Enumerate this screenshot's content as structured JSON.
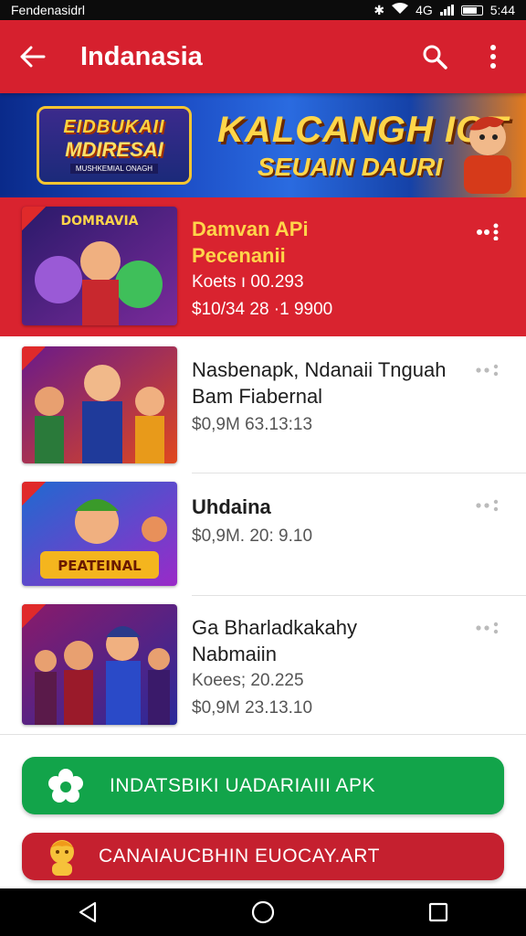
{
  "status_bar": {
    "carrier": "Fendenasidrl",
    "time": "5:44",
    "net_label": "4G"
  },
  "app_bar": {
    "title": "Indanasia",
    "icons": [
      "back-arrow-icon",
      "search-icon",
      "more-vert-icon"
    ]
  },
  "banner": {
    "badge_line1": "EIDBUKAII",
    "badge_line2": "MDIRESAI",
    "badge_line3": "MUSHKEMIAL ONAGH",
    "headline": "KALCANGH IGT",
    "subline": "SEUAIN DAURI"
  },
  "items": [
    {
      "title_lines": [
        "Damvan APi",
        "Pecenanii"
      ],
      "meta_lines": [
        "Koets ı 00.293",
        "$10/34  28 ·1 9900"
      ],
      "featured": true
    },
    {
      "title_lines": [
        "Nasbenapk, Ndanaii Tnguah",
        "Bam Fiabernal"
      ],
      "meta_lines": [
        "$0,9M  63.13:13"
      ],
      "featured": false
    },
    {
      "title_lines": [
        "Uhdaina"
      ],
      "meta_lines": [
        "$0,9M.  20: 9.10"
      ],
      "featured": false
    },
    {
      "title_lines": [
        "Ga Bharladkakahy",
        "Nabmaiin"
      ],
      "meta_lines": [
        "Koees; 20.225",
        "$0,9M  23.13.10"
      ],
      "featured": false
    }
  ],
  "buttons": {
    "download_label": "INDATSBIKI  UADARIAIII APK",
    "second_label": "CANAIAUCBHIN EUOCAY.ART"
  },
  "nav": [
    "back-triangle-icon",
    "home-circle-icon",
    "recents-square-icon"
  ],
  "colors": {
    "primary_red": "#d6202e",
    "featured_red": "#d9232f",
    "title_yellow": "#ffd54a",
    "download_green": "#12a44a",
    "second_red": "#c5202f"
  }
}
